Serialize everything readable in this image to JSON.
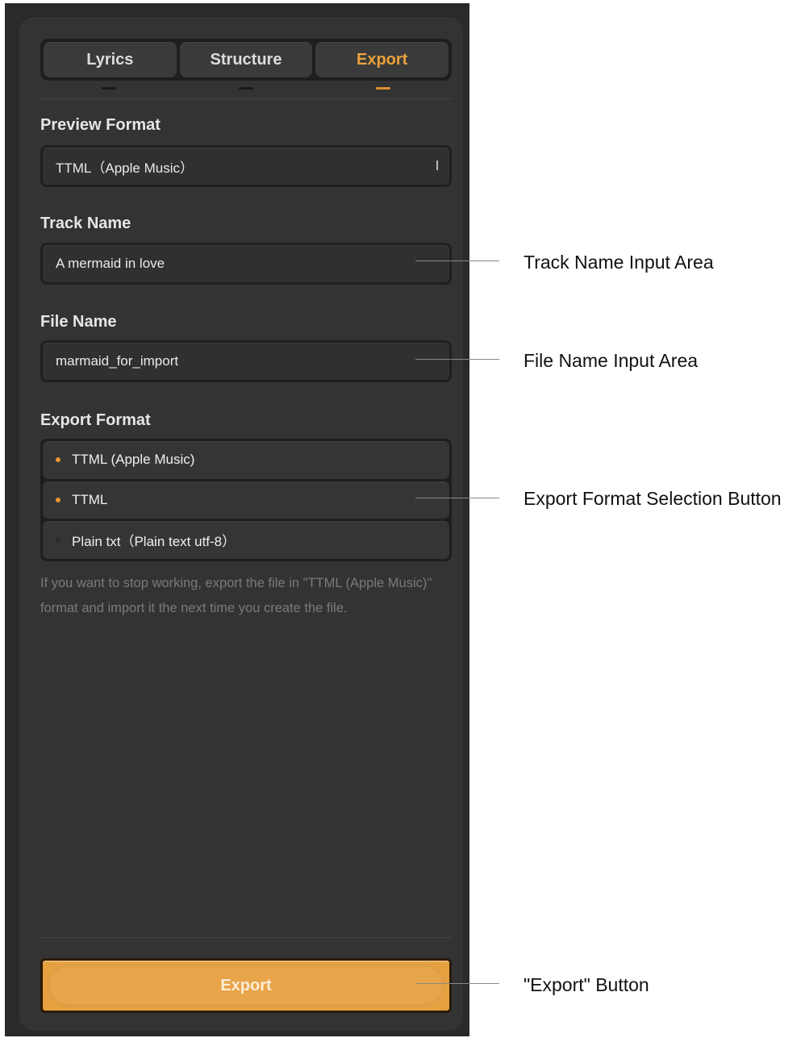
{
  "tabs": [
    {
      "label": "Lyrics",
      "active": false
    },
    {
      "label": "Structure",
      "active": false
    },
    {
      "label": "Export",
      "active": true
    }
  ],
  "preview_format": {
    "label": "Preview Format",
    "value": "TTML（Apple Music）"
  },
  "track_name": {
    "label": "Track Name",
    "value": "A mermaid in love"
  },
  "file_name": {
    "label": "File Name",
    "value": "marmaid_for_import"
  },
  "export_format": {
    "label": "Export Format",
    "options": [
      {
        "label": "TTML (Apple Music)",
        "selected": true
      },
      {
        "label": "TTML",
        "selected": true
      },
      {
        "label": "Plain txt（Plain text utf-8）",
        "selected": false
      }
    ]
  },
  "hint": "If you want to stop working, export the file in \"TTML (Apple Music)\" format and import it the next time you create the file.",
  "export_button": {
    "label": "Export"
  },
  "callouts": {
    "track_name": "Track Name Input Area",
    "file_name": "File Name Input Area",
    "export_format": "Export Format Selection Button",
    "export_button": "\"Export\" Button"
  },
  "colors": {
    "accent": "#e9a13b",
    "panel": "#333333",
    "button": "#e5a040"
  }
}
